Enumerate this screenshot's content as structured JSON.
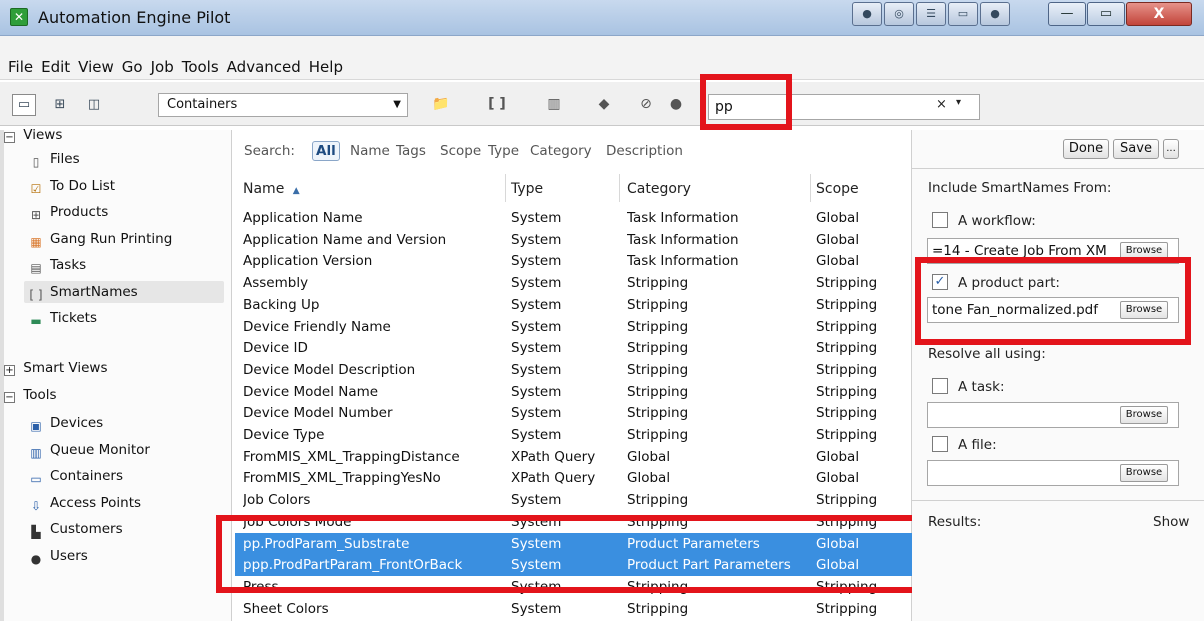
{
  "window": {
    "title": "Automation Engine Pilot",
    "icon_name": "app-icon",
    "minimize_glyph": "—",
    "maximize_glyph": "▭",
    "close_glyph": "X"
  },
  "menu": [
    "File",
    "Edit",
    "View",
    "Go",
    "Job",
    "Tools",
    "Advanced",
    "Help"
  ],
  "toolbar": {
    "container_selector": "Containers",
    "search_value": "pp",
    "clear_glyph": "×",
    "dropdown_glyph": "▾"
  },
  "sidebar": {
    "views_label": "Views",
    "views_items": [
      {
        "label": "Files",
        "icon": "file-icon"
      },
      {
        "label": "To Do List",
        "icon": "todo-icon"
      },
      {
        "label": "Products",
        "icon": "products-icon"
      },
      {
        "label": "Gang Run Printing",
        "icon": "gang-run-icon"
      },
      {
        "label": "Tasks",
        "icon": "tasks-icon"
      },
      {
        "label": "SmartNames",
        "icon": "smartnames-icon"
      },
      {
        "label": "Tickets",
        "icon": "tickets-icon"
      }
    ],
    "smart_views_label": "Smart Views",
    "tools_label": "Tools",
    "tools_items": [
      {
        "label": "Devices",
        "icon": "devices-icon"
      },
      {
        "label": "Queue Monitor",
        "icon": "queue-monitor-icon"
      },
      {
        "label": "Containers",
        "icon": "containers-icon"
      },
      {
        "label": "Access Points",
        "icon": "access-points-icon"
      },
      {
        "label": "Customers",
        "icon": "customers-icon"
      },
      {
        "label": "Users",
        "icon": "users-icon"
      }
    ]
  },
  "search_filters": {
    "label": "Search:",
    "options": [
      "All",
      "Name",
      "Tags",
      "Scope",
      "Type",
      "Category",
      "Description"
    ]
  },
  "table": {
    "columns": [
      "Name",
      "Type",
      "Category",
      "Scope"
    ],
    "sort_glyph": "▲",
    "rows": [
      [
        "Application Name",
        "System",
        "Task Information",
        "Global"
      ],
      [
        "Application Name and Version",
        "System",
        "Task Information",
        "Global"
      ],
      [
        "Application Version",
        "System",
        "Task Information",
        "Global"
      ],
      [
        "Assembly",
        "System",
        "Stripping",
        "Stripping"
      ],
      [
        "Backing Up",
        "System",
        "Stripping",
        "Stripping"
      ],
      [
        "Device Friendly Name",
        "System",
        "Stripping",
        "Stripping"
      ],
      [
        "Device ID",
        "System",
        "Stripping",
        "Stripping"
      ],
      [
        "Device Model Description",
        "System",
        "Stripping",
        "Stripping"
      ],
      [
        "Device Model Name",
        "System",
        "Stripping",
        "Stripping"
      ],
      [
        "Device Model Number",
        "System",
        "Stripping",
        "Stripping"
      ],
      [
        "Device Type",
        "System",
        "Stripping",
        "Stripping"
      ],
      [
        "FromMIS_XML_TrappingDistance",
        "XPath Query",
        "Global",
        "Global"
      ],
      [
        "FromMIS_XML_TrappingYesNo",
        "XPath Query",
        "Global",
        "Global"
      ],
      [
        "Job Colors",
        "System",
        "Stripping",
        "Stripping"
      ],
      [
        "Job Colors Mode",
        "System",
        "Stripping",
        "Stripping"
      ],
      [
        "pp.ProdParam_Substrate",
        "System",
        "Product Parameters",
        "Global"
      ],
      [
        "ppp.ProdPartParam_FrontOrBack",
        "System",
        "Product Part Parameters",
        "Global"
      ],
      [
        "Press",
        "System",
        "Stripping",
        "Stripping"
      ],
      [
        "Sheet Colors",
        "System",
        "Stripping",
        "Stripping"
      ]
    ],
    "selected_rows": [
      15,
      16
    ]
  },
  "right_panel": {
    "done_label": "Done",
    "save_label": "Save",
    "more_label": "...",
    "include_label": "Include SmartNames From:",
    "workflow_label": "A workflow:",
    "workflow_value": "=14 - Create Job From XM",
    "product_part_label": "A product part:",
    "product_part_value": "tone Fan_normalized.pdf",
    "product_part_checked": true,
    "resolve_label": "Resolve all using:",
    "task_label": "A task:",
    "task_value": "",
    "file_label": "A file:",
    "file_value": "",
    "browse_label": "Browse",
    "results_label": "Results:",
    "show_label": "Show",
    "check_glyph": "✓"
  },
  "colors": {
    "selection": "#3a8fe0",
    "highlight_box": "#e3141b"
  }
}
